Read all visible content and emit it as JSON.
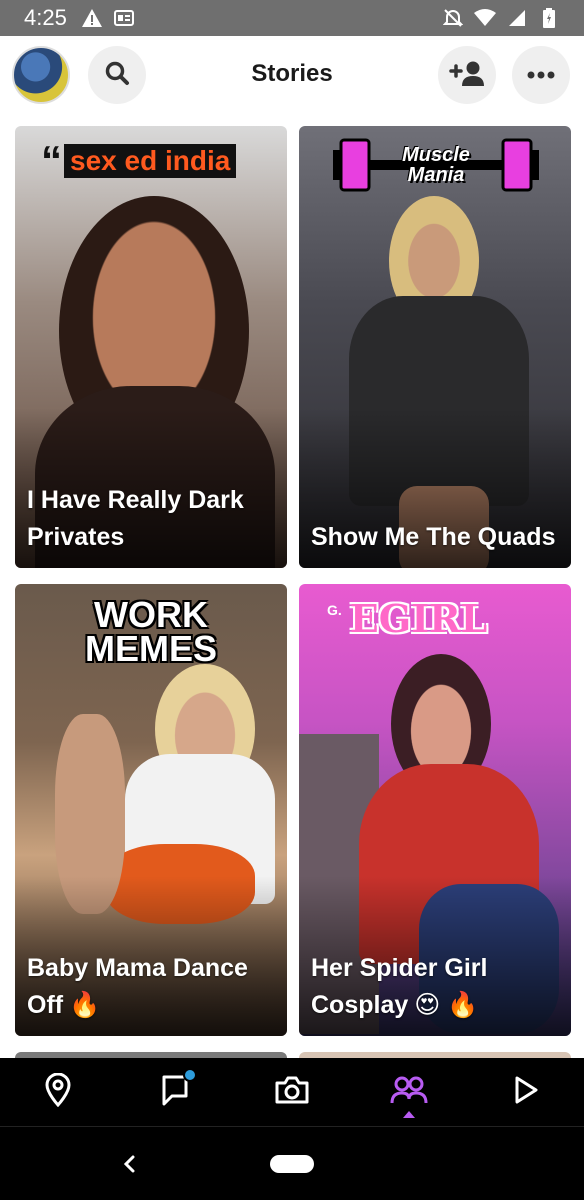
{
  "status_bar": {
    "time": "4:25",
    "left_icons": [
      "warning-icon",
      "news-icon"
    ],
    "right_icons": [
      "dnd-off-icon",
      "wifi-icon",
      "signal-icon",
      "battery-icon"
    ]
  },
  "header": {
    "title": "Stories",
    "avatar_icon": "avatar",
    "search_icon": "search-icon",
    "add_friend_icon": "add-friend-icon",
    "more_icon": "more-icon"
  },
  "stories": [
    {
      "publisher": {
        "text": "sex ed india",
        "quote_mark": "“"
      },
      "title": "I Have Really Dark Privates",
      "emoji": ""
    },
    {
      "publisher": {
        "line1": "Muscle",
        "line2": "Mania"
      },
      "title": "Show Me The Quads",
      "emoji": ""
    },
    {
      "publisher": {
        "line1": "WORK",
        "line2": "MEMES"
      },
      "title": "Baby Mama Dance Off",
      "emoji": "🔥"
    },
    {
      "publisher": {
        "prefix": "G.",
        "name": "EGIRL"
      },
      "title": "Her Spider Girl Cosplay",
      "emoji": "😍 🔥"
    }
  ],
  "bottom_nav": {
    "items": [
      "map-icon",
      "chat-icon",
      "camera-icon",
      "stories-icon",
      "spotlight-icon"
    ],
    "active": "stories-icon",
    "accent": "#b85cf2",
    "badge_color": "#2d9cdb"
  },
  "colors": {
    "header_bg": "#ffffff",
    "button_bg": "#efefef",
    "status_bar_bg": "#6f6f6f"
  }
}
